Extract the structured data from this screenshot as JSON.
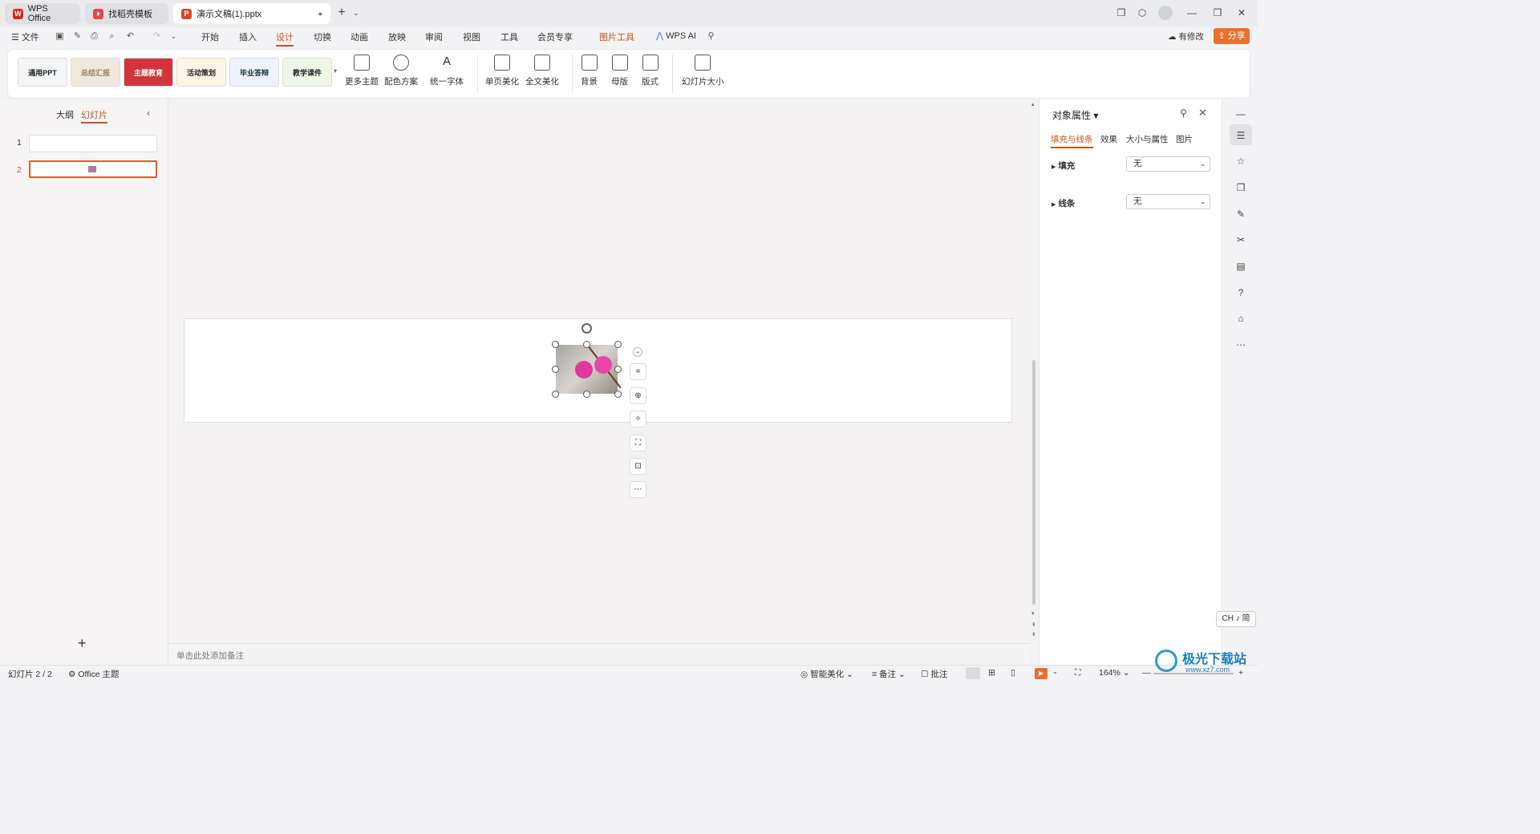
{
  "tabs": [
    {
      "label": "WPS Office"
    },
    {
      "label": "找稻壳模板"
    },
    {
      "label": "演示文稿(1).pptx"
    }
  ],
  "menu": {
    "file": "文件",
    "items": [
      "开始",
      "插入",
      "设计",
      "切换",
      "动画",
      "放映",
      "审阅",
      "视图",
      "工具",
      "会员专享"
    ],
    "picture_tools": "图片工具",
    "wps_ai": "WPS AI",
    "has_changes": "有修改",
    "share": "分享"
  },
  "ribbon": {
    "themes": [
      "通用PPT",
      "总结汇报",
      "主题教育",
      "活动策划",
      "毕业答辩",
      "教学课件"
    ],
    "buttons": [
      "更多主题",
      "配色方案",
      "统一字体",
      "单页美化",
      "全文美化",
      "背景",
      "母版",
      "版式",
      "幻灯片大小"
    ]
  },
  "left": {
    "tab_outline": "大纲",
    "tab_slides": "幻灯片",
    "slide_numbers": [
      "1",
      "2"
    ],
    "add": "+"
  },
  "notes_placeholder": "单击此处添加备注",
  "props": {
    "title": "对象属性",
    "tabs": [
      "填充与线条",
      "效果",
      "大小与属性",
      "图片"
    ],
    "fill_label": "填充",
    "fill_value": "无",
    "line_label": "线条",
    "line_value": "无"
  },
  "ime": "CH ♪ 简",
  "status": {
    "slide": "幻灯片 2 / 2",
    "theme": "Office 主题",
    "smart": "智能美化",
    "notes": "备注",
    "comment": "批注",
    "zoom": "164%"
  },
  "watermark": "极光下载站",
  "watermark_url": "www.xz7.com",
  "colors": {
    "accent": "#c7541b",
    "share_bg": "#e8712f"
  }
}
